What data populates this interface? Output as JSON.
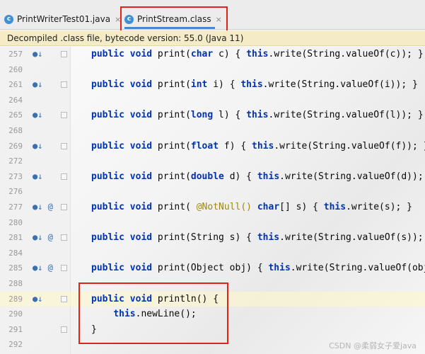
{
  "tabs": [
    {
      "icon": "c",
      "label": "PrintWriterTest01.java",
      "close": "×"
    },
    {
      "icon": "c",
      "label": "PrintStream.class",
      "close": "×"
    }
  ],
  "banner": {
    "text": "Decompiled .class file, bytecode version: 55.0 (Java 11)"
  },
  "lines": [
    {
      "num": "257",
      "icons": "●↓",
      "fold": true
    },
    {
      "num": "260",
      "icons": "",
      "fold": false
    },
    {
      "num": "261",
      "icons": "●↓",
      "fold": true
    },
    {
      "num": "264",
      "icons": "",
      "fold": false
    },
    {
      "num": "265",
      "icons": "●↓",
      "fold": true
    },
    {
      "num": "268",
      "icons": "",
      "fold": false
    },
    {
      "num": "269",
      "icons": "●↓",
      "fold": true
    },
    {
      "num": "272",
      "icons": "",
      "fold": false
    },
    {
      "num": "273",
      "icons": "●↓",
      "fold": true
    },
    {
      "num": "276",
      "icons": "",
      "fold": false
    },
    {
      "num": "277",
      "icons": "●↓ @",
      "fold": true
    },
    {
      "num": "280",
      "icons": "",
      "fold": false
    },
    {
      "num": "281",
      "icons": "●↓ @",
      "fold": true
    },
    {
      "num": "284",
      "icons": "",
      "fold": false
    },
    {
      "num": "285",
      "icons": "●↓ @",
      "fold": true
    },
    {
      "num": "288",
      "icons": "",
      "fold": false
    },
    {
      "num": "289",
      "icons": "●↓",
      "fold": true
    },
    {
      "num": "290",
      "icons": "",
      "fold": false
    },
    {
      "num": "291",
      "icons": "",
      "fold": true
    },
    {
      "num": "292",
      "icons": "",
      "fold": false
    }
  ],
  "code": {
    "l257": {
      "rest1": " print(",
      "type": "char",
      "rest2": " c) { ",
      "this": "this",
      "rest3": ".write(String.valueOf(c)); }"
    },
    "l261": {
      "rest1": " print(",
      "type": "int",
      "rest2": " i) { ",
      "this": "this",
      "rest3": ".write(String.valueOf(i)); }"
    },
    "l265": {
      "rest1": " print(",
      "type": "long",
      "rest2": " l) { ",
      "this": "this",
      "rest3": ".write(String.valueOf(l)); }"
    },
    "l269": {
      "rest1": " print(",
      "type": "float",
      "rest2": " f) { ",
      "this": "this",
      "rest3": ".write(String.valueOf(f)); }"
    },
    "l273": {
      "rest1": " print(",
      "type": "double",
      "rest2": " d) { ",
      "this": "this",
      "rest3": ".write(String.valueOf(d)); }"
    },
    "l277": {
      "rest1": " print( ",
      "anno": "@NotNull()",
      "sp": " ",
      "type": "char",
      "rest2": "[] s) { ",
      "this": "this",
      "rest3": ".write(s); }"
    },
    "l281": {
      "rest1": " print(String s) { ",
      "this": "this",
      "rest3": ".write(String.valueOf(s)); }"
    },
    "l285": {
      "rest1": " print(Object obj) { ",
      "this": "this",
      "rest3": ".write(String.valueOf(obj))"
    },
    "l289": {
      "rest1": " println() {"
    },
    "l290": {
      "this": "this",
      "rest3": ".newLine();"
    },
    "l291": {
      "rest1": "}"
    }
  },
  "keywords": {
    "public": "public",
    "void": "void"
  },
  "watermark": "CSDN @柔弱女子爱java"
}
